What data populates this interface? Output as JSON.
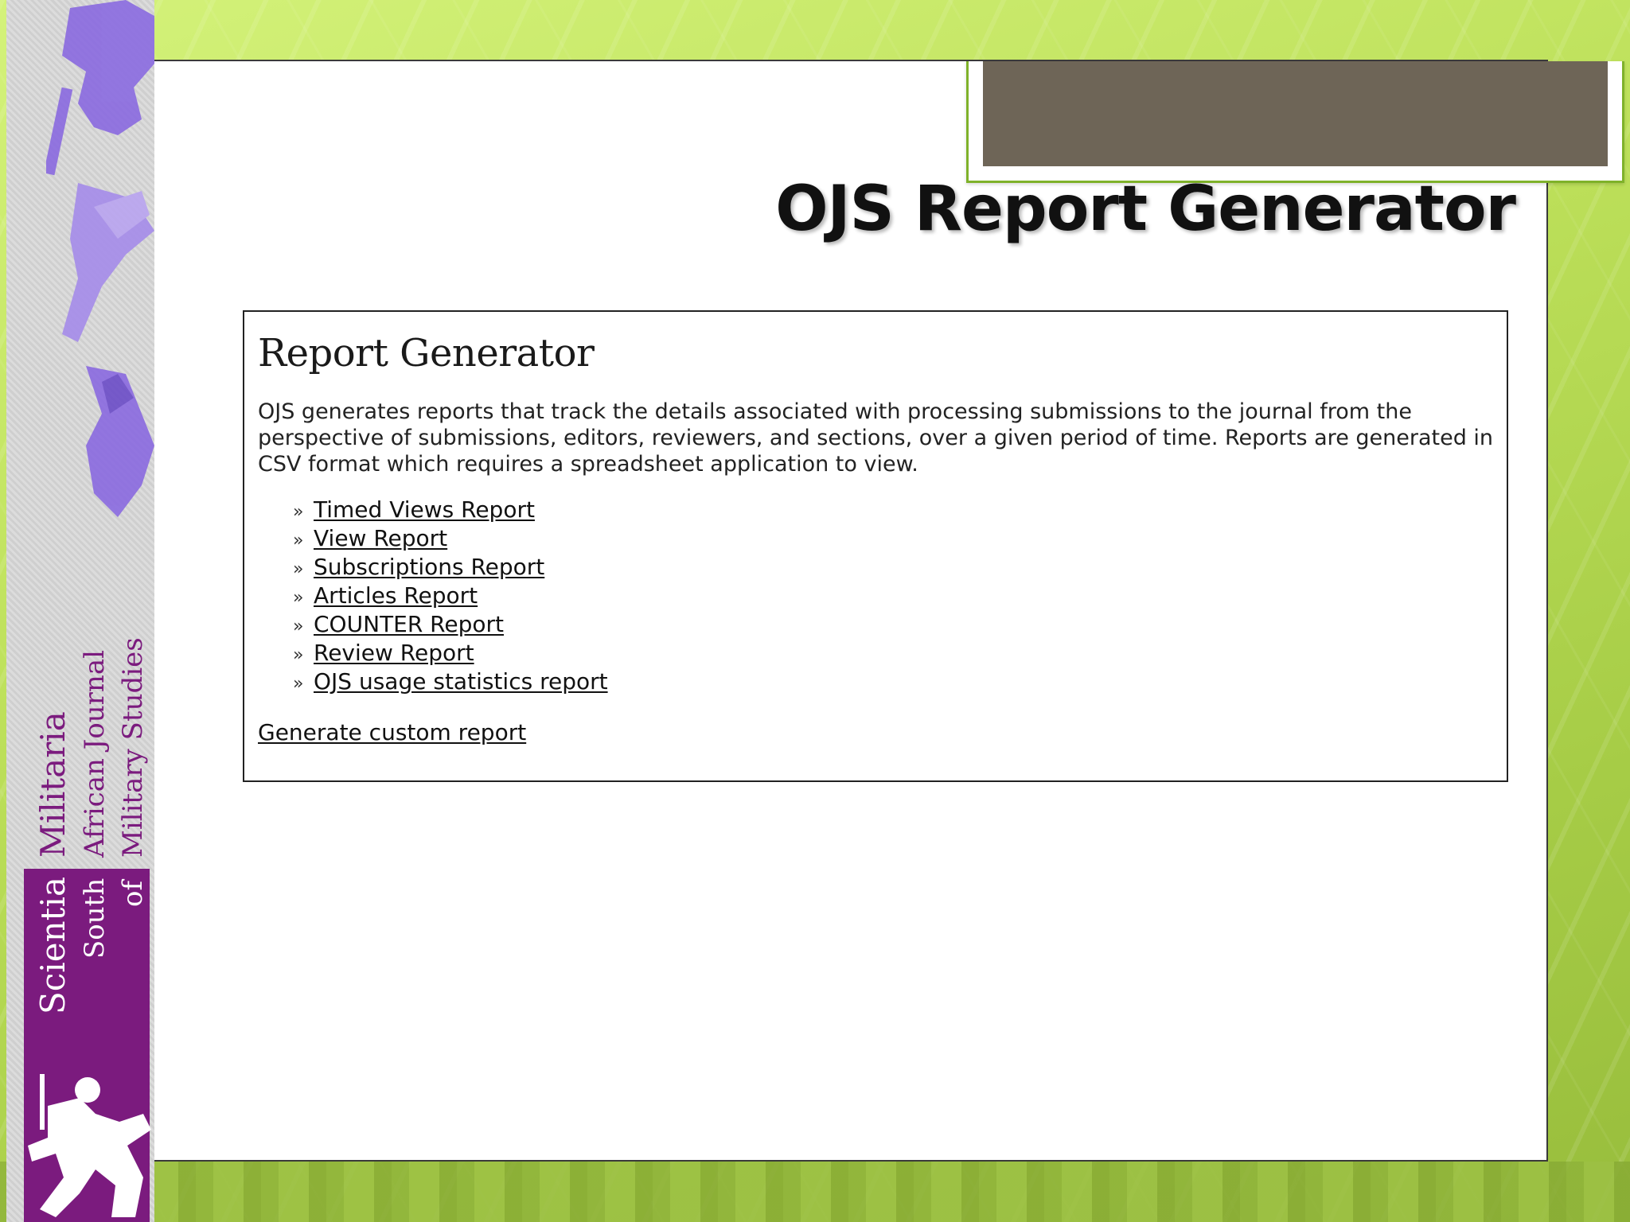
{
  "journal_banner": {
    "word1": "Scientia",
    "word2": "Militaria",
    "line2a": "South",
    "line2b": "African Journal",
    "line3a": "of",
    "line3b": "Military Studies"
  },
  "slide": {
    "title": "OJS Report Generator"
  },
  "report_generator": {
    "heading": "Report Generator",
    "description": "OJS generates reports that track the details associated with processing submissions to the journal from the perspective of submissions, editors, reviewers, and sections, over a given period of time. Reports are generated in CSV format which requires a spreadsheet application to view.",
    "bullet": "»",
    "reports": [
      "Timed Views Report",
      "View Report",
      "Subscriptions Report",
      "Articles Report",
      "COUNTER Report",
      "Review Report",
      "OJS usage statistics report"
    ],
    "custom_report_link": "Generate custom report"
  },
  "colors": {
    "background_green": "#bde05a",
    "header_bar": "#6e6557",
    "header_border": "#7fb22a",
    "journal_purple": "#7b1b7e",
    "art_violet": "#8a6ae0"
  }
}
